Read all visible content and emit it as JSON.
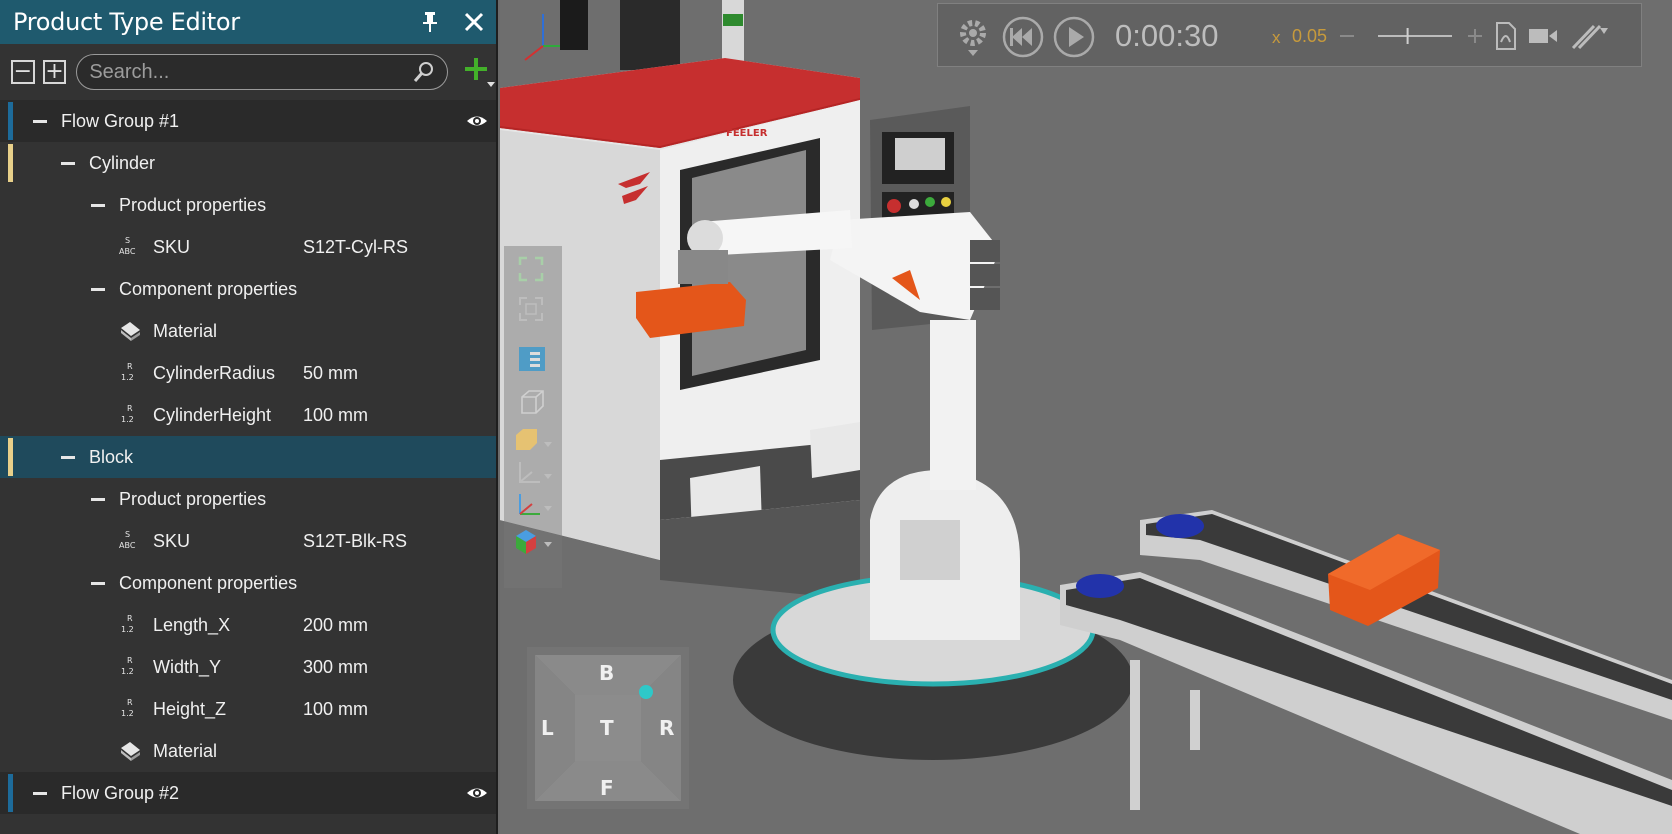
{
  "panel": {
    "title": "Product Type Editor",
    "pin_icon": "pin-icon",
    "close_icon": "close-icon",
    "collapse_all_label": "−",
    "expand_all_label": "+",
    "search_placeholder": "Search...",
    "add_icon": "plus-green-icon",
    "accent": "#1f5a6e",
    "group_bar_color": "#1d6b9a",
    "type_bar_color": "#e8d08a"
  },
  "tree": {
    "group1": {
      "label": "Flow Group #1"
    },
    "cylinder": {
      "label": "Cylinder",
      "product_props": "Product properties",
      "sku": {
        "label": "SKU",
        "value": "S12T-Cyl-RS"
      },
      "component_props": "Component properties",
      "material": {
        "label": "Material"
      },
      "radius": {
        "label": "CylinderRadius",
        "value": "50 mm"
      },
      "height": {
        "label": "CylinderHeight",
        "value": "100 mm"
      }
    },
    "block": {
      "label": "Block",
      "product_props": "Product properties",
      "sku": {
        "label": "SKU",
        "value": "S12T-Blk-RS"
      },
      "component_props": "Component properties",
      "length": {
        "label": "Length_X",
        "value": "200 mm"
      },
      "width": {
        "label": "Width_Y",
        "value": "300 mm"
      },
      "height": {
        "label": "Height_Z",
        "value": "100 mm"
      },
      "material": {
        "label": "Material"
      }
    },
    "group2": {
      "label": "Flow Group #2"
    }
  },
  "playback": {
    "time": "0:00:30",
    "speed_prefix": "x",
    "speed": "0.05",
    "slider_fraction": 0.4
  },
  "navcube": {
    "top": "B",
    "left": "L",
    "center": "T",
    "right": "R",
    "bottom": "F"
  },
  "machine": {
    "brand": "FEELER"
  }
}
